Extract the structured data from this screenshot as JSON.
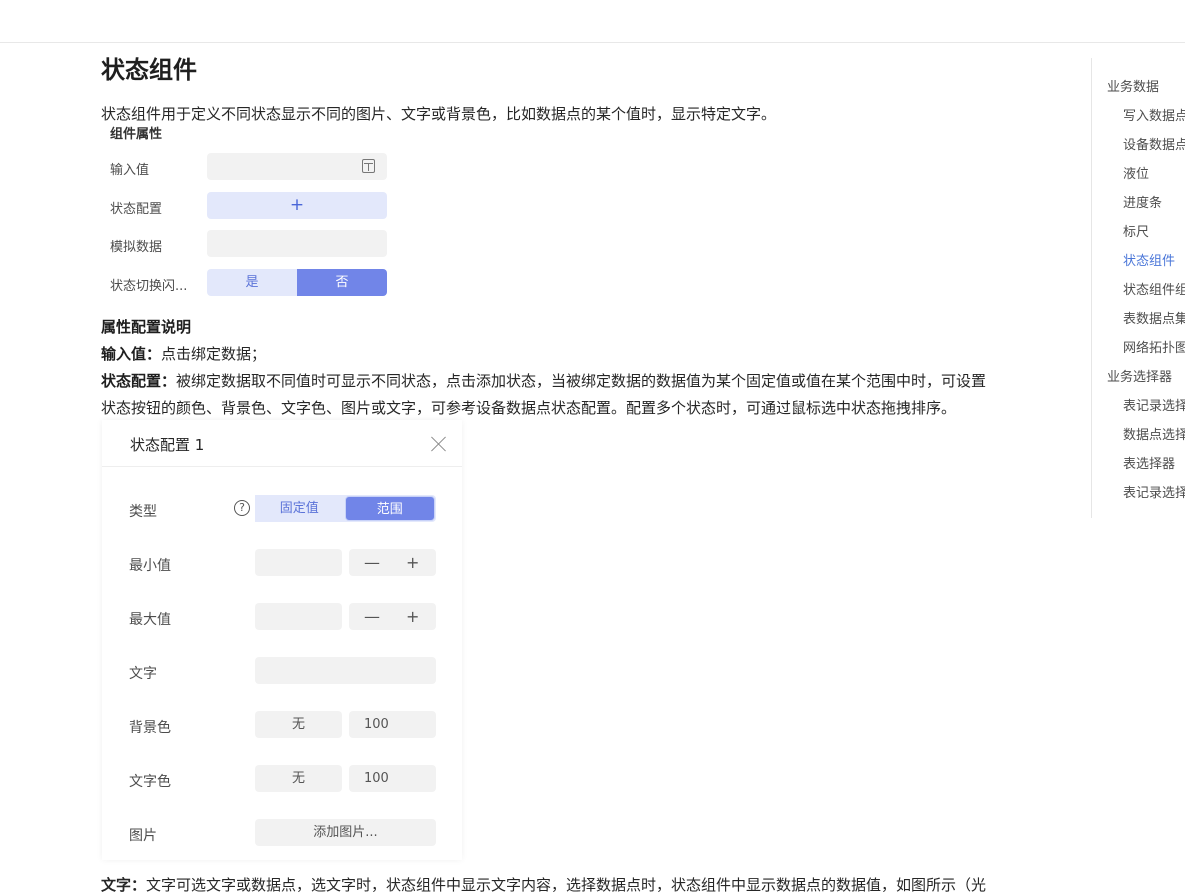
{
  "page": {
    "title": "状态组件",
    "intro": "状态组件用于定义不同状态显示不同的图片、文字或背景色，比如数据点的某个值时，显示特定文字。"
  },
  "props_panel": {
    "title": "组件属性",
    "rows": [
      {
        "label": "输入值",
        "icon": "calculator-icon"
      },
      {
        "label": "状态配置",
        "add_label": "+"
      },
      {
        "label": "模拟数据"
      },
      {
        "label": "状态切换闪...",
        "options": [
          "是",
          "否"
        ],
        "selected": "否"
      }
    ]
  },
  "description": {
    "heading": "属性配置说明",
    "input_label": "输入值：",
    "input_text": "点击绑定数据；",
    "config_label": "状态配置：",
    "config_text_1": "被绑定数据取不同值时可显示不同状态，点击添加状态，当被绑定数据的数据值为某个固定值或值在某个范围中时，可设置",
    "config_text_2": "状态按钮的颜色、背景色、文字色、图片或文字，可参考设备数据点状态配置。配置多个状态时，可通过鼠标选中状态拖拽排序。",
    "bottom_label": "文字：",
    "bottom_text": "文字可选文字或数据点，选文字时，状态组件中显示文字内容，选择数据点时，状态组件中显示数据点的数据值，如图所示（光"
  },
  "dialog": {
    "title": "状态配置 1",
    "type": {
      "label": "类型",
      "help": "?",
      "options": [
        "固定值",
        "范围"
      ],
      "selected": "范围"
    },
    "min": {
      "label": "最小值",
      "minus": "—",
      "plus": "+"
    },
    "max": {
      "label": "最大值",
      "minus": "—",
      "plus": "+"
    },
    "text": {
      "label": "文字"
    },
    "bg_color": {
      "label": "背景色",
      "color": "无",
      "opacity": "100"
    },
    "text_color": {
      "label": "文字色",
      "color": "无",
      "opacity": "100"
    },
    "image": {
      "label": "图片",
      "button": "添加图片..."
    }
  },
  "toc": {
    "items": [
      {
        "label": "业务数据",
        "level": 1
      },
      {
        "label": "写入数据点",
        "level": 2
      },
      {
        "label": "设备数据点",
        "level": 2
      },
      {
        "label": "液位",
        "level": 2
      },
      {
        "label": "进度条",
        "level": 2
      },
      {
        "label": "标尺",
        "level": 2
      },
      {
        "label": "状态组件",
        "level": 2,
        "active": true
      },
      {
        "label": "状态组件组",
        "level": 2
      },
      {
        "label": "表数据点集",
        "level": 2
      },
      {
        "label": "网络拓扑图",
        "level": 2
      },
      {
        "label": "业务选择器",
        "level": 1
      },
      {
        "label": "表记录选择",
        "level": 2
      },
      {
        "label": "数据点选择",
        "level": 2
      },
      {
        "label": "表选择器",
        "level": 2
      },
      {
        "label": "表记录选择",
        "level": 2
      }
    ],
    "active_color": "#4a76d8"
  },
  "colors": {
    "accent": "#7185e8",
    "accent_light": "#e3e8fb",
    "input_bg": "#f2f2f2"
  }
}
